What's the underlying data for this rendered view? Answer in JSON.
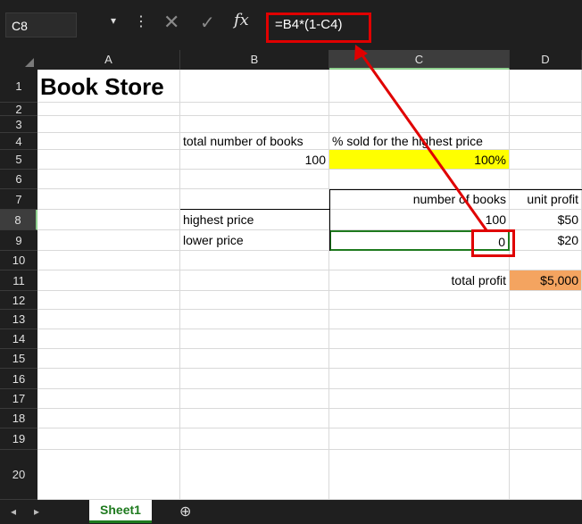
{
  "formula_bar": {
    "name_box": "C8",
    "cancel_glyph": "✕",
    "enter_glyph": "✓",
    "fx_label": "fx",
    "formula": "=B4*(1-C4)"
  },
  "columns": [
    "A",
    "B",
    "C",
    "D"
  ],
  "rows": [
    "1",
    "2",
    "3",
    "4",
    "5",
    "6",
    "7",
    "8",
    "9",
    "10",
    "11",
    "12",
    "13",
    "14",
    "15",
    "16",
    "17",
    "18",
    "19",
    "20"
  ],
  "cells": {
    "A1": "Book Store",
    "B3": "total number of books",
    "C3": "% sold for the highest price",
    "B4": "100",
    "C4": "100%",
    "C6": "number of books",
    "D6": "unit profit",
    "B7": "highest price",
    "C7": "100",
    "D7": "$50",
    "B8": "lower price",
    "C8": "0",
    "D8": "$20",
    "C10": "total profit",
    "D10": "$5,000"
  },
  "colors": {
    "input_highlight": "#ffff00",
    "output_highlight": "#f4a460",
    "annotation": "#e00000",
    "selection": "#1e7a1e"
  },
  "bottom_bar": {
    "sheet_tab": "Sheet1",
    "add_sheet_glyph": "+"
  }
}
